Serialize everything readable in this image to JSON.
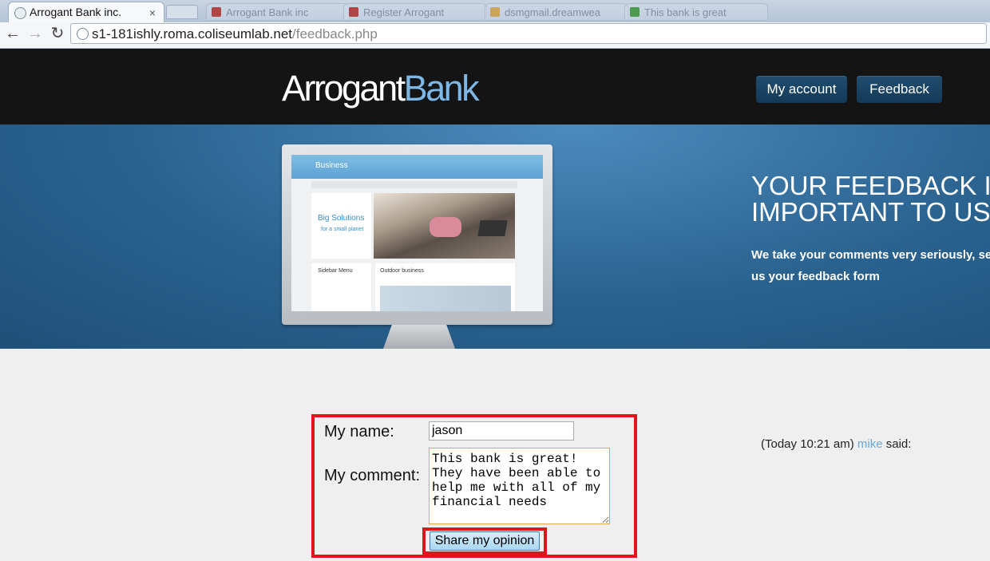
{
  "browser": {
    "active_tab_title": "Arrogant Bank inc.",
    "close_glyph": "×",
    "ghost_tabs": [
      "Arrogant Bank inc",
      "Register Arrogant",
      "dsmgmail.dreamwea",
      "This bank is great"
    ],
    "url_host": "s1-181ishly.roma.coliseumlab.net",
    "url_path": "/feedback.php",
    "back_glyph": "←",
    "forward_glyph": "→",
    "reload_glyph": "↻"
  },
  "site": {
    "logo_part1": "Arrogant",
    "logo_part2": "Bank",
    "nav": {
      "my_account": "My account",
      "feedback": "Feedback"
    }
  },
  "hero": {
    "headline_line1": "YOUR FEEDBACK IS",
    "headline_line2": "IMPORTANT TO US",
    "subtext": "We take your comments very seriously, send us your feedback form",
    "mock_screen": {
      "brand": "Business",
      "promo_title": "Big Solutions",
      "promo_sub": "for a small planet",
      "sidebar_title": "Sidebar Menu",
      "main_title": "Outdoor business"
    }
  },
  "form": {
    "name_label": "My name:",
    "name_value": "jason",
    "comment_label": "My comment:",
    "comment_value": "This bank is great! They have been able to help me with all of my financial needs",
    "submit_label": "Share my opinion"
  },
  "comment_entry": {
    "time": "(Today 10:21 am)",
    "author": "mike",
    "suffix": "said:"
  },
  "colors": {
    "accent_red": "#e0141e",
    "link_blue": "#6aa7d8",
    "header_bg": "#141414"
  }
}
